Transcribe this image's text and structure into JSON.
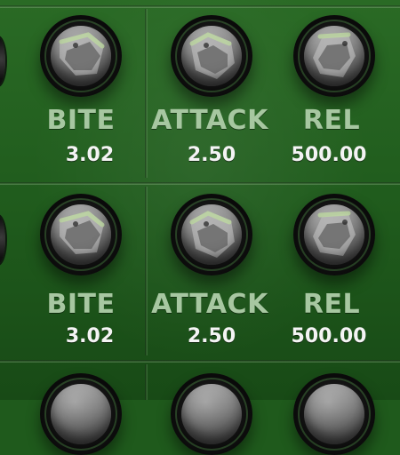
{
  "rows": [
    {
      "knobs": [
        {
          "label": "BITE",
          "value": "3.02",
          "icon": "knob-icon"
        },
        {
          "label": "ATTACK",
          "value": "2.50",
          "icon": "knob-icon"
        },
        {
          "label": "REL",
          "value": "500.00",
          "icon": "knob-icon"
        }
      ]
    },
    {
      "knobs": [
        {
          "label": "BITE",
          "value": "3.02",
          "icon": "knob-icon"
        },
        {
          "label": "ATTACK",
          "value": "2.50",
          "icon": "knob-icon"
        },
        {
          "label": "REL",
          "value": "500.00",
          "icon": "knob-icon"
        }
      ]
    }
  ],
  "colors": {
    "background": "#1f5a1c",
    "label": "#a7c7a1",
    "value": "#f4f4f4",
    "knob_dark": "#0a0a0a",
    "knob_face": "#7f7f7f",
    "knob_accent": "#9ec07a"
  }
}
